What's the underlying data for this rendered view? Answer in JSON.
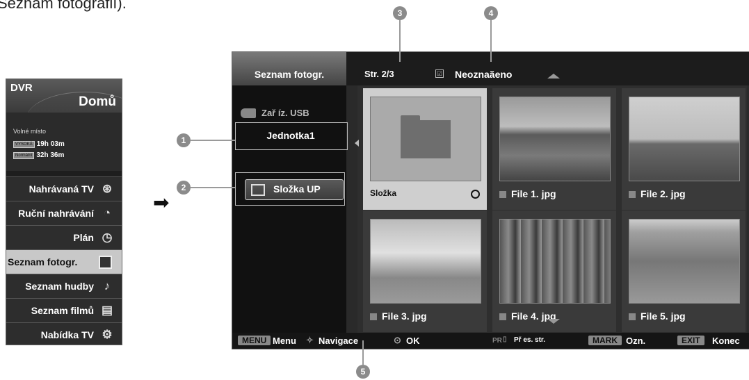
{
  "intro_text": "Seznam fotografií).",
  "dvr_menu": {
    "label": "DVR",
    "home": "Domů",
    "free_space_title": "Volné místo",
    "rows": [
      {
        "tag": "VYSOKÁ",
        "time": "19h 03m"
      },
      {
        "tag": "Normální",
        "time": "32h 36m"
      }
    ],
    "items": [
      {
        "label": "Nahrávaná TV",
        "icon": "film-reel-icon",
        "glyph": "⊛"
      },
      {
        "label": "Ruční nahrávání",
        "icon": "clock-record-icon",
        "glyph": "◔"
      },
      {
        "label": "Plán",
        "icon": "schedule-clock-icon",
        "glyph": "◷"
      },
      {
        "label": "Seznam fotogr.",
        "icon": "photo-icon",
        "glyph": ""
      },
      {
        "label": "Seznam hudby",
        "icon": "music-note-icon",
        "glyph": "♪"
      },
      {
        "label": "Seznam filmů",
        "icon": "movie-icon",
        "glyph": "▤"
      },
      {
        "label": "Nabídka TV",
        "icon": "gears-icon",
        "glyph": "⚙"
      }
    ],
    "selected_index": 3
  },
  "pointer_arrow": "➡",
  "callouts": [
    "1",
    "2",
    "3",
    "4",
    "5"
  ],
  "screen": {
    "title": "Seznam fotogr.",
    "page": "Str. 2/3",
    "check_glyph": "☑",
    "unmark": "Neoznaãeno",
    "usb_device": "Zař íz. USB",
    "drive": "Jednotka1",
    "up_folder": "Složka UP",
    "cells": [
      {
        "label": "Složka",
        "type": "folder",
        "selected": true
      },
      {
        "label": "File 1. jpg",
        "type": "photo",
        "selected": false
      },
      {
        "label": "File 2. jpg",
        "type": "photo",
        "selected": false
      },
      {
        "label": "File 3. jpg",
        "type": "photo",
        "selected": false
      },
      {
        "label": "File 4. jpg",
        "type": "photo",
        "selected": false
      },
      {
        "label": "File 5. jpg",
        "type": "photo",
        "selected": false
      }
    ]
  },
  "bottom_bar": {
    "menu_key": "MENU",
    "menu_label": "Menu",
    "nav_label": "Navigace",
    "ok_label": "OK",
    "pr_key": "PR",
    "page_label": "Př es. str.",
    "mark_key": "MARK",
    "mark_label": "Ozn.",
    "exit_key": "EXIT",
    "exit_label": "Konec"
  }
}
